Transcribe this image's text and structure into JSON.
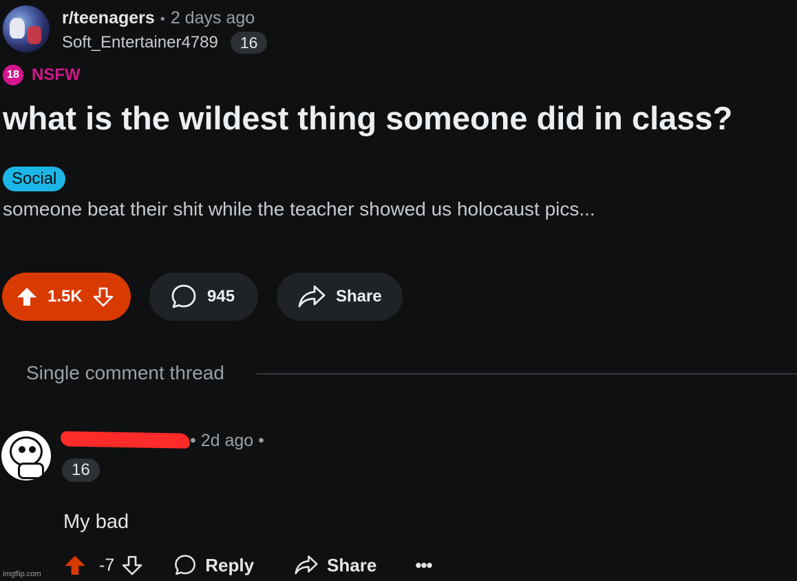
{
  "post": {
    "subreddit": "r/teenagers",
    "separator": "•",
    "time_ago": "2 days ago",
    "author": "Soft_Entertainer4789",
    "author_badge": "16",
    "nsfw_icon_text": "18",
    "nsfw_label": "NSFW",
    "title": "what is the wildest thing someone did in class?",
    "flair": "Social",
    "flair_color": "#1cb6e6",
    "body": "someone beat their shit while the teacher showed us holocaust pics...",
    "vote_count": "1.5K",
    "comment_count": "945",
    "share_label": "Share",
    "upvote_color": "#d93a00"
  },
  "thread": {
    "label": "Single comment thread"
  },
  "comment": {
    "meta": "• 2d ago •",
    "author_badge": "16",
    "text": "My bad",
    "score": "-7",
    "reply_label": "Reply",
    "share_label": "Share",
    "more_label": "•••"
  },
  "watermark": "imgflip.com"
}
